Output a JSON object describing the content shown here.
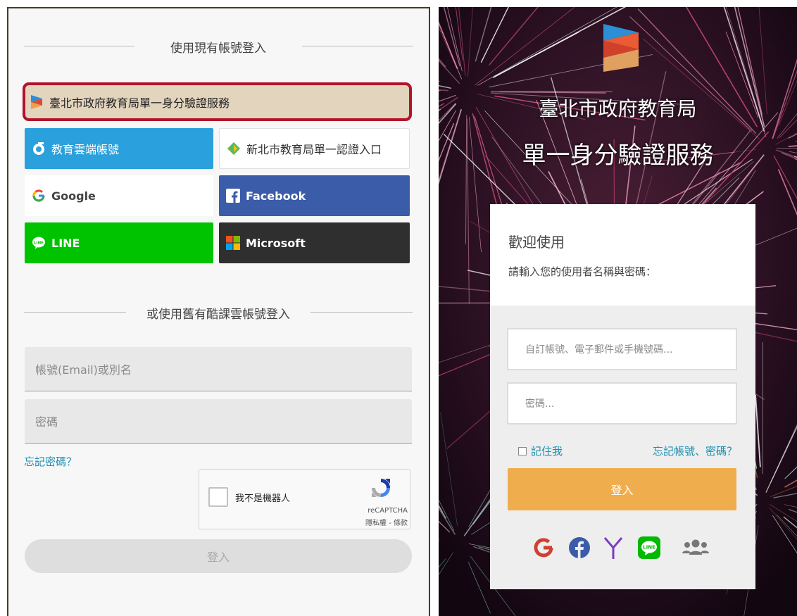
{
  "left_panel": {
    "section1_title": "使用現有帳號登入",
    "sso_button_label": "臺北市政府教育局單一身分驗證服務",
    "providers": {
      "edu_cloud": "教育雲端帳號",
      "ntpc": "新北市教育局單一認證入口",
      "google": "Google",
      "facebook": "Facebook",
      "line": "LINE",
      "microsoft": "Microsoft"
    },
    "section2_title": "或使用舊有酷課雲帳號登入",
    "account_placeholder": "帳號(Email)或別名",
    "password_placeholder": "密碼",
    "forgot_password": "忘記密碼？",
    "recaptcha": {
      "label": "我不是機器人",
      "brand": "reCAPTCHA",
      "terms": "隱私權 - 條款"
    },
    "submit_label": "登入"
  },
  "right_panel": {
    "title_line1": "臺北市政府教育局",
    "title_line2": "單一身分驗證服務",
    "welcome": "歡迎使用",
    "instruction": "請輸入您的使用者名稱與密碼：",
    "username_placeholder": "自訂帳號、電子郵件或手機號碼...",
    "password_placeholder": "密碼...",
    "remember_me": "記住我",
    "forgot": "忘記帳號、密碼？",
    "submit_label": "登入",
    "social_icons": [
      "google-icon",
      "facebook-icon",
      "yahoo-icon",
      "line-icon",
      "group-icon"
    ]
  },
  "colors": {
    "sso_highlight_border": "#b2142a",
    "sso_bg": "#e2d4bd",
    "edu_cloud_blue": "#2aa0dc",
    "facebook_blue": "#3b5ca8",
    "line_green": "#00c300",
    "microsoft_dark": "#2f2f2f",
    "link_teal": "#1a8fb0",
    "login_orange": "#f0ad4e"
  }
}
